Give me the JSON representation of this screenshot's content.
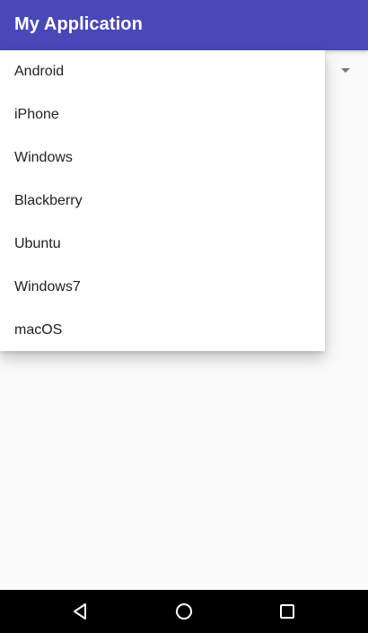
{
  "appbar": {
    "title": "My Application",
    "color": "#4a48b8"
  },
  "spinner": {
    "icon": "dropdown-arrow-icon"
  },
  "dropdown": {
    "items": [
      {
        "label": "Android"
      },
      {
        "label": "iPhone"
      },
      {
        "label": "Windows"
      },
      {
        "label": "Blackberry"
      },
      {
        "label": "Ubuntu"
      },
      {
        "label": "Windows7"
      },
      {
        "label": "macOS"
      }
    ]
  },
  "navbar": {
    "buttons": [
      {
        "icon": "back-icon"
      },
      {
        "icon": "home-icon"
      },
      {
        "icon": "recents-icon"
      }
    ]
  }
}
